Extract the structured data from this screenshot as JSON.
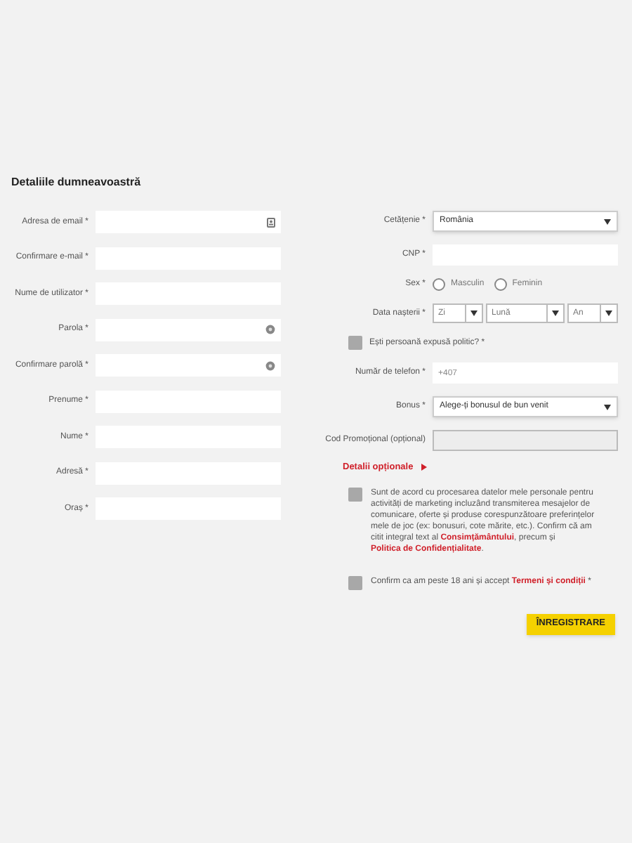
{
  "title": "Detaliile dumneavoastră",
  "left_fields": [
    {
      "label": "Adresa de email *",
      "kind": "email"
    },
    {
      "label": "Confirmare e-mail *",
      "kind": "text"
    },
    {
      "label": "Nume de utilizator *",
      "kind": "text"
    },
    {
      "label": "Parola *",
      "kind": "password"
    },
    {
      "label": "Confirmare parolă *",
      "kind": "password"
    },
    {
      "label": "Prenume *",
      "kind": "text"
    },
    {
      "label": "Nume *",
      "kind": "text"
    },
    {
      "label": "Adresă *",
      "kind": "text"
    },
    {
      "label": "Oraș *",
      "kind": "text"
    }
  ],
  "right_fields": [
    {
      "kind": "select",
      "label": "Cetățenie *",
      "value": "România"
    },
    {
      "kind": "text",
      "label": "CNP *"
    },
    {
      "kind": "radio",
      "label": "Sex *",
      "options": [
        {
          "label": "Masculin",
          "selected": false
        },
        {
          "label": "Feminin",
          "selected": false
        }
      ]
    },
    {
      "kind": "date",
      "label": "Data nașterii *",
      "parts": [
        "Zi",
        "Lună",
        "An"
      ]
    },
    {
      "kind": "checkbox",
      "label": "Ești persoană expusă politic? *",
      "checked": false
    },
    {
      "kind": "text",
      "label": "Număr de telefon *",
      "placeholder": "+407"
    },
    {
      "kind": "select",
      "label": "Bonus *",
      "value": "Alege-ți bonusul de bun venit"
    },
    {
      "kind": "text",
      "label": "Cod Promoțional (opțional)",
      "disabled": true
    }
  ],
  "optional_link": "Detalii opționale",
  "consents": [
    {
      "checked": false,
      "parts": [
        {
          "kind": "plain",
          "text": "Sunt de acord cu procesarea datelor mele personale pentru activități de marketing incluzând transmiterea mesajelor de comunicare, oferte și produse corespunzătoare preferințelor mele de joc (ex: bonusuri, cote mărite, etc.). Confirm că am citit integral text al "
        },
        {
          "kind": "link",
          "text": "Consimțământului"
        },
        {
          "kind": "plain",
          "text": ", precum și "
        },
        {
          "kind": "link",
          "text": "Politica de Confidențialitate"
        },
        {
          "kind": "plain",
          "text": "."
        }
      ]
    },
    {
      "checked": false,
      "parts": [
        {
          "kind": "plain",
          "text": "Confirm ca am peste 18 ani și accept "
        },
        {
          "kind": "link",
          "text": "Termeni și condiții"
        },
        {
          "kind": "plain",
          "text": " *"
        }
      ]
    }
  ],
  "submit": "ÎNREGISTRARE"
}
